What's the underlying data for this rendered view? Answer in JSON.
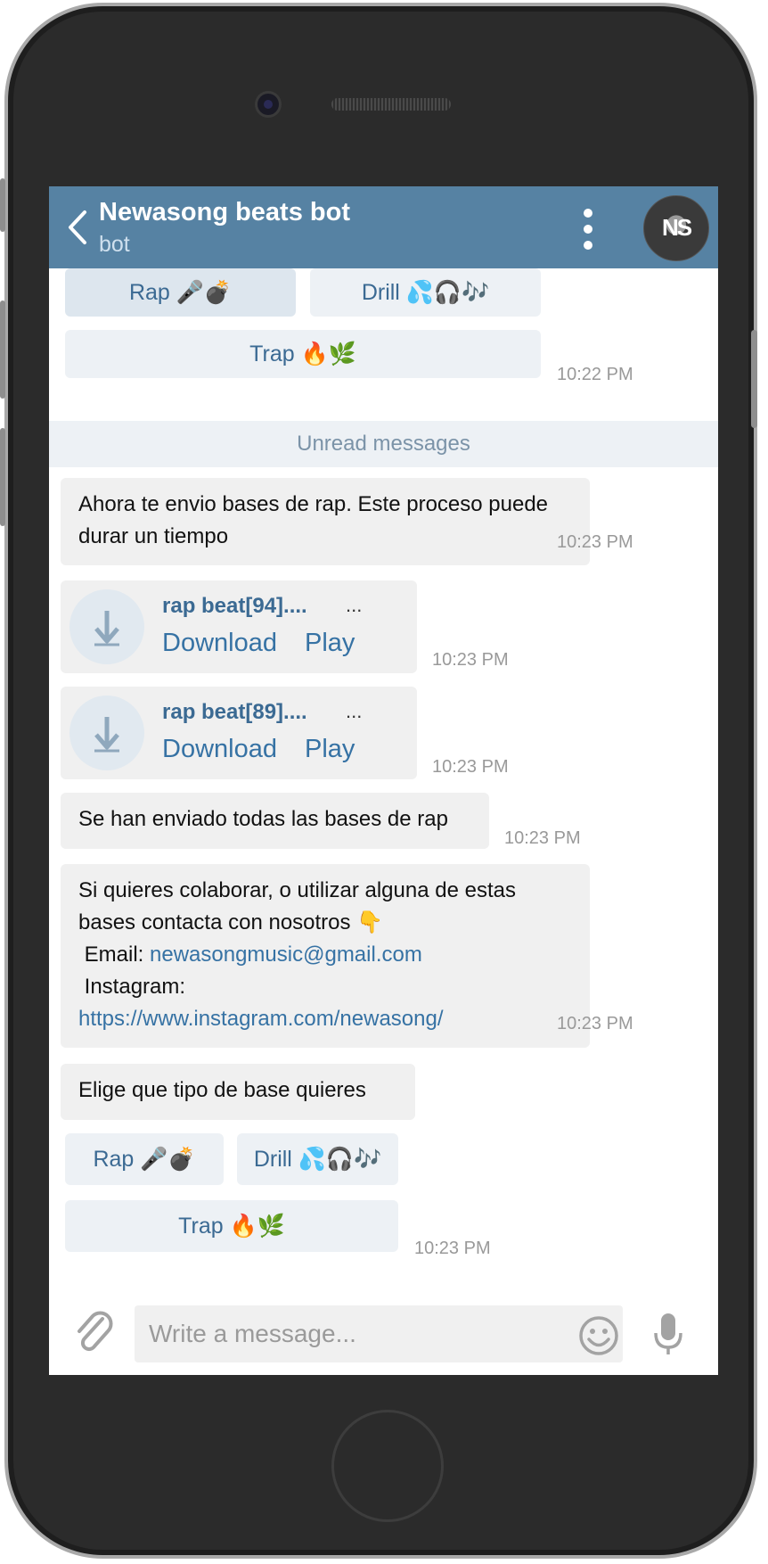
{
  "header": {
    "title": "Newasong beats bot",
    "subtitle": "bot",
    "avatar_text": "NS"
  },
  "keyboard_top": {
    "buttons": [
      "Rap 🎤💣",
      "Drill 💦🎧🎶",
      "Trap 🔥🌿"
    ],
    "time": "10:22 PM"
  },
  "unread_label": "Unread messages",
  "messages": [
    {
      "text": "Ahora te envio bases de rap. Este proceso puede durar un tiempo",
      "time": "10:23 PM"
    },
    {
      "file": "rap beat[94]....",
      "more": "...",
      "download": "Download",
      "play": "Play",
      "time": "10:23 PM"
    },
    {
      "file": "rap beat[89]....",
      "more": "...",
      "download": "Download",
      "play": "Play",
      "time": "10:23 PM"
    },
    {
      "text": "Se han enviado todas las bases de rap",
      "time": "10:23 PM"
    },
    {
      "line1": "Si quieres colaborar, o utilizar alguna de estas bases contacta con nosotros 👇",
      "email_label": " Email: ",
      "email": "newasongmusic@gmail.com",
      "instagram_label": " Instagram: ",
      "instagram_url": "https://www.instagram.com/newasong/",
      "time": "10:23 PM"
    },
    {
      "text": "Elige que tipo de base quieres"
    }
  ],
  "keyboard_bottom": {
    "buttons": [
      "Rap 🎤💣",
      "Drill 💦🎧🎶",
      "Trap 🔥🌿"
    ],
    "time": "10:23 PM"
  },
  "composer": {
    "placeholder": "Write a message..."
  },
  "colors": {
    "header": "#5682a3",
    "link": "#3672a4",
    "bubble": "#f0f0f0",
    "keyboard_button": "#edf1f5"
  },
  "icons": [
    "back-arrow-icon",
    "more-vertical-icon",
    "download-arrow-icon",
    "paperclip-icon",
    "smiley-icon",
    "microphone-icon"
  ]
}
